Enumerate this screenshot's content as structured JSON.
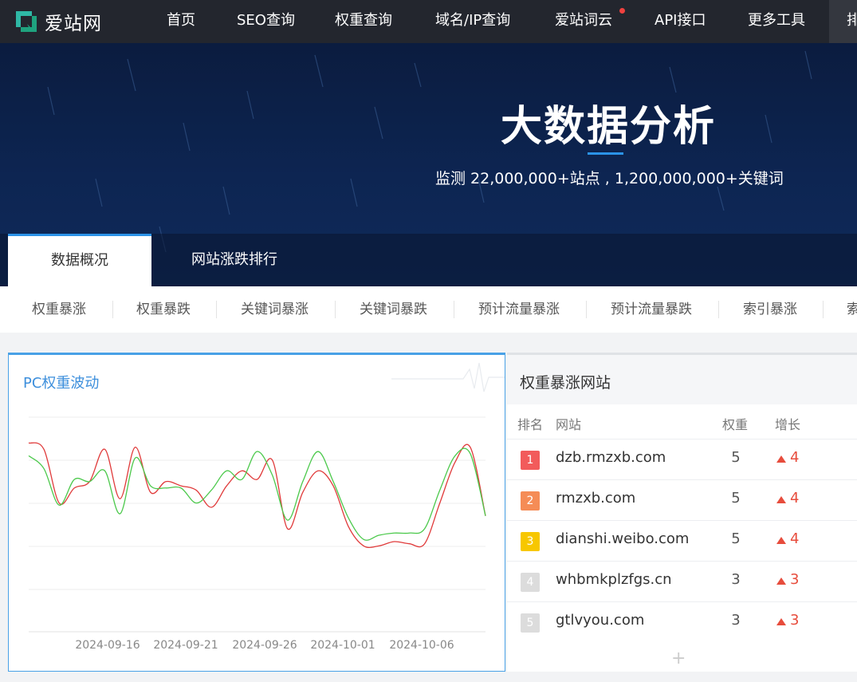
{
  "nav": {
    "logo_text": "爱站网",
    "items": [
      "首页",
      "SEO查询",
      "权重查询",
      "域名/IP查询",
      "爱站词云",
      "API接口",
      "更多工具"
    ],
    "overflow_label": "排"
  },
  "hero": {
    "title": "大数据分析",
    "subtitle": "监测 22,000,000+站点 , 1,200,000,000+关键词"
  },
  "tabs": [
    "数据概况",
    "网站涨跌排行"
  ],
  "subtabs": [
    "权重暴涨",
    "权重暴跌",
    "关键词暴涨",
    "关键词暴跌",
    "预计流量暴涨",
    "预计流量暴跌",
    "索引暴涨",
    "索"
  ],
  "left_card": {
    "title": "PC权重波动"
  },
  "chart_data": {
    "type": "line",
    "title": "PC权重波动",
    "x_tick_labels": [
      "2024-09-16",
      "2024-09-21",
      "2024-09-26",
      "2024-10-01",
      "2024-10-06"
    ],
    "grid": true,
    "series": [
      {
        "color": "#e03a3a",
        "values": [
          0.88,
          0.85,
          0.6,
          0.67,
          0.7,
          0.85,
          0.62,
          0.86,
          0.65,
          0.7,
          0.68,
          0.66,
          0.58,
          0.68,
          0.75,
          0.71,
          0.8,
          0.48,
          0.65,
          0.75,
          0.68,
          0.49,
          0.4,
          0.4,
          0.42,
          0.41,
          0.41,
          0.6,
          0.79,
          0.86,
          0.54
        ]
      },
      {
        "color": "#4cc94c",
        "values": [
          0.82,
          0.76,
          0.59,
          0.71,
          0.7,
          0.75,
          0.55,
          0.81,
          0.68,
          0.67,
          0.67,
          0.6,
          0.66,
          0.75,
          0.71,
          0.84,
          0.73,
          0.52,
          0.7,
          0.84,
          0.7,
          0.53,
          0.43,
          0.45,
          0.46,
          0.46,
          0.48,
          0.66,
          0.82,
          0.83,
          0.54
        ]
      }
    ],
    "colors": {
      "series_1": "#e03a3a",
      "series_2": "#4cc94c"
    }
  },
  "right_card": {
    "title": "权重暴涨网站",
    "headers": {
      "rank": "排名",
      "site": "网站",
      "weight": "权重",
      "growth": "增长"
    },
    "rows": [
      {
        "rank": "1",
        "site": "dzb.rmzxb.com",
        "weight": "5",
        "growth": "4",
        "badge_color": "#f25b5b"
      },
      {
        "rank": "2",
        "site": "rmzxb.com",
        "weight": "5",
        "growth": "4",
        "badge_color": "#f58c56"
      },
      {
        "rank": "3",
        "site": "dianshi.weibo.com",
        "weight": "5",
        "growth": "4",
        "badge_color": "#f7c700"
      },
      {
        "rank": "4",
        "site": "whbmkplzfgs.cn",
        "weight": "3",
        "growth": "3",
        "badge_color": "#dcdcdc"
      },
      {
        "rank": "5",
        "site": "gtlvyou.com",
        "weight": "3",
        "growth": "3",
        "badge_color": "#dcdcdc"
      }
    ]
  },
  "colors": {
    "accent": "#2b93e8",
    "nav_bg": "#23262e",
    "up": "#e74c3c"
  }
}
